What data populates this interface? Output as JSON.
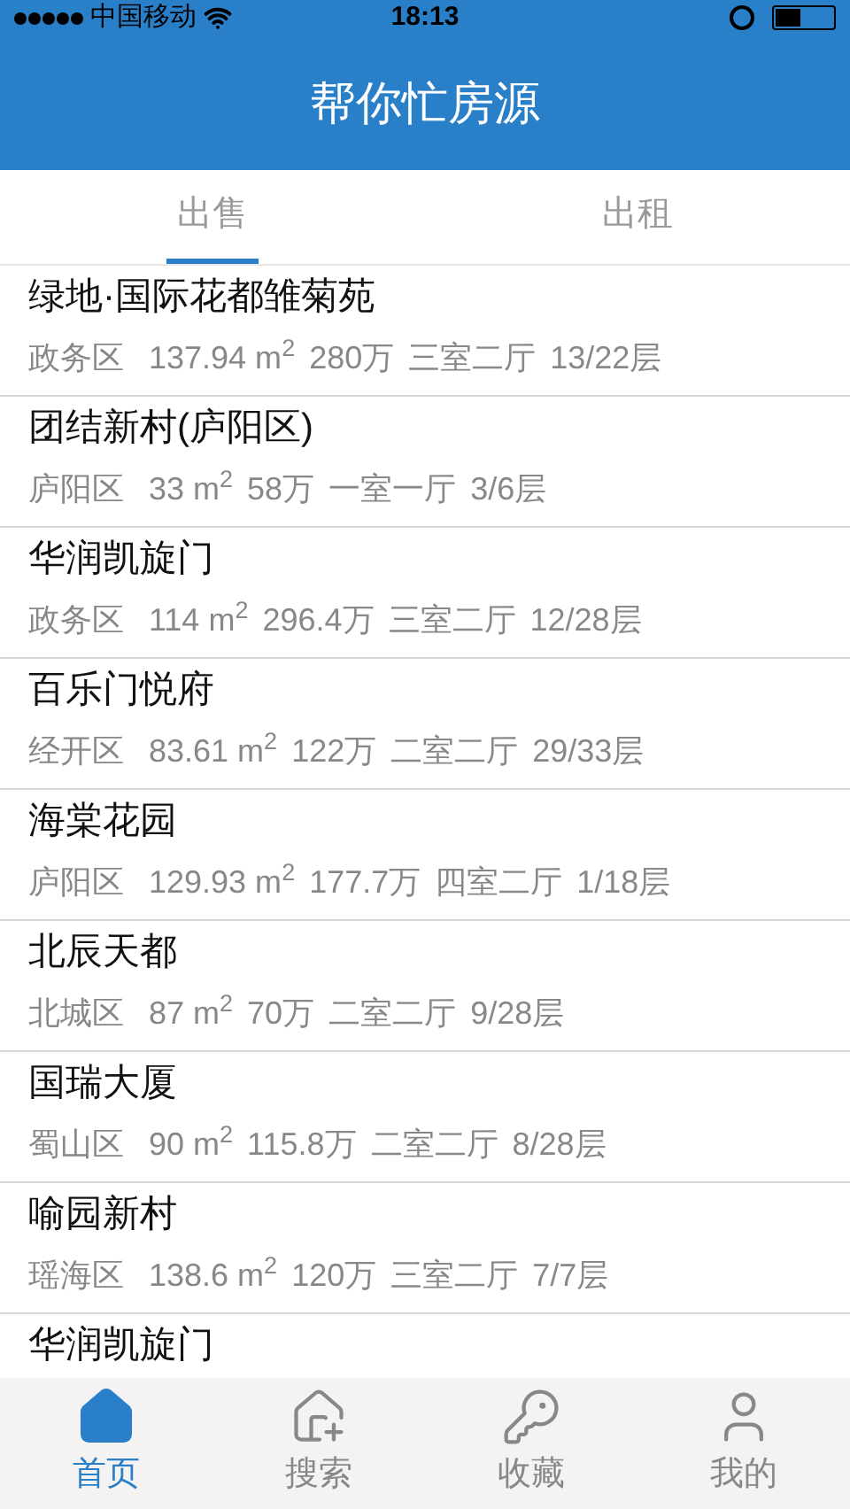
{
  "status_bar": {
    "carrier": "中国移动",
    "time": "18:13"
  },
  "header": {
    "title": "帮你忙房源"
  },
  "tabs": [
    {
      "label": "出售",
      "selected": true
    },
    {
      "label": "出租",
      "selected": false
    }
  ],
  "listings": [
    {
      "name": "绿地·国际花都雏菊苑",
      "district": "政务区",
      "area": "137.94 m$^{2}$",
      "price": "280万",
      "layout": "三室二厅",
      "floor": "13/22层"
    },
    {
      "name": "团结新村(庐阳区)",
      "district": "庐阳区",
      "area": "33 m$^{2}$",
      "price": "58万",
      "layout": "一室一厅",
      "floor": "3/6层"
    },
    {
      "name": "华润凯旋门",
      "district": "政务区",
      "area": "114 m$^{2}$",
      "price": "296.4万",
      "layout": "三室二厅",
      "floor": "12/28层"
    },
    {
      "name": "百乐门悦府",
      "district": "经开区",
      "area": "83.61 m$^{2}$",
      "price": "122万",
      "layout": "二室二厅",
      "floor": "29/33层"
    },
    {
      "name": "海棠花园",
      "district": "庐阳区",
      "area": "129.93 m$^{2}$",
      "price": "177.7万",
      "layout": "四室二厅",
      "floor": "1/18层"
    },
    {
      "name": "北辰天都",
      "district": "北城区",
      "area": "87 m$^{2}$",
      "price": "70万",
      "layout": "二室二厅",
      "floor": "9/28层"
    },
    {
      "name": "国瑞大厦",
      "district": "蜀山区",
      "area": "90 m$^{2}$",
      "price": "115.8万",
      "layout": "二室二厅",
      "floor": "8/28层"
    },
    {
      "name": "喻园新村",
      "district": "瑶海区",
      "area": "138.6 m$^{2}$",
      "price": "120万",
      "layout": "三室二厅",
      "floor": "7/7层"
    },
    {
      "name": "华润凯旋门"
    }
  ],
  "tab_bar": [
    {
      "label": "首页",
      "selected": true
    },
    {
      "label": "搜索",
      "selected": false
    },
    {
      "label": "收藏",
      "selected": false
    },
    {
      "label": "我的",
      "selected": false
    }
  ]
}
